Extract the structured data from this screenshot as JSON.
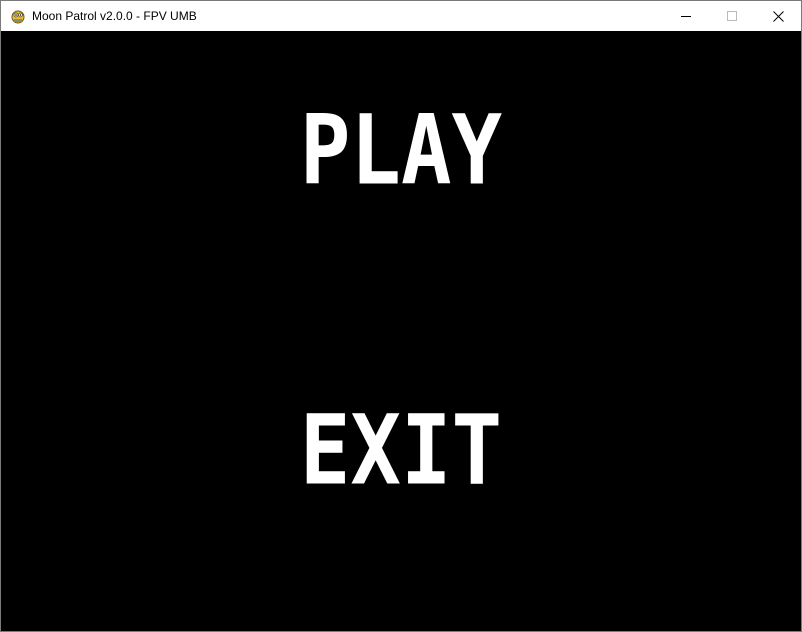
{
  "window": {
    "title": "Moon Patrol v2.0.0 - FPV UMB",
    "icon": "pygame-snake-icon"
  },
  "controls": {
    "minimize": "minimize-icon",
    "maximize": "maximize-icon",
    "close": "close-icon"
  },
  "menu": {
    "items": [
      {
        "label": "PLAY"
      },
      {
        "label": "EXIT"
      }
    ]
  }
}
